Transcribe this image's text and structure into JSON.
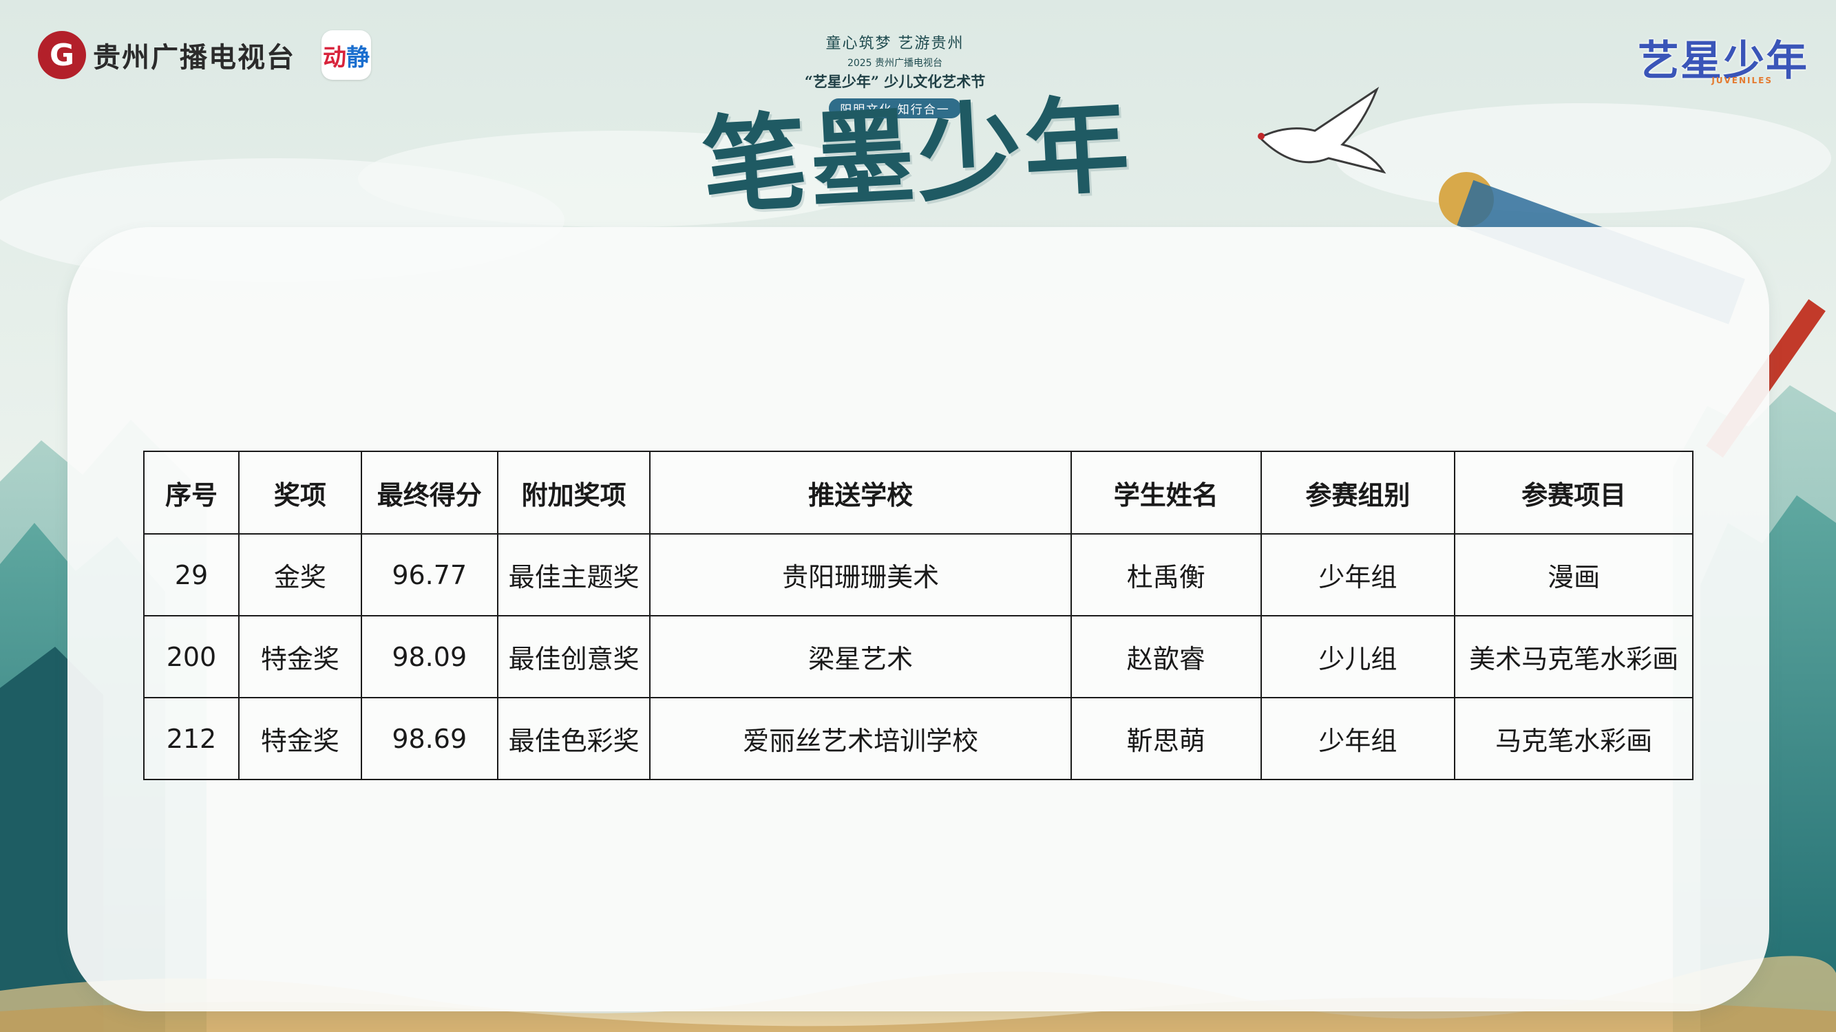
{
  "header": {
    "logo_mark": "G",
    "broadcaster": "贵州广播电视台",
    "app_badge_part1": "动",
    "app_badge_part2": "静",
    "slogan": "童心筑梦  艺游贵州",
    "sub_org": "2025 贵州广播电视台",
    "festival": "“艺星少年” 少儿文化艺术节",
    "tagline": "阳明文化  知行合一",
    "big_title": "笔墨少年",
    "brand_right": "艺星少年",
    "brand_right_sub": "JUVENILES"
  },
  "colors": {
    "accent_red": "#b3202a",
    "title_teal": "#1f5a63",
    "brand_blue": "#3a55b8"
  },
  "table": {
    "headers": [
      "序号",
      "奖项",
      "最终得分",
      "附加奖项",
      "推送学校",
      "学生姓名",
      "参赛组别",
      "参赛项目"
    ],
    "rows": [
      [
        "29",
        "金奖",
        "96.77",
        "最佳主题奖",
        "贵阳珊珊美术",
        "杜禹衡",
        "少年组",
        "漫画"
      ],
      [
        "200",
        "特金奖",
        "98.09",
        "最佳创意奖",
        "梁星艺术",
        "赵歆睿",
        "少儿组",
        "美术马克笔水彩画"
      ],
      [
        "212",
        "特金奖",
        "98.69",
        "最佳色彩奖",
        "爱丽丝艺术培训学校",
        "靳思萌",
        "少年组",
        "马克笔水彩画"
      ]
    ]
  }
}
